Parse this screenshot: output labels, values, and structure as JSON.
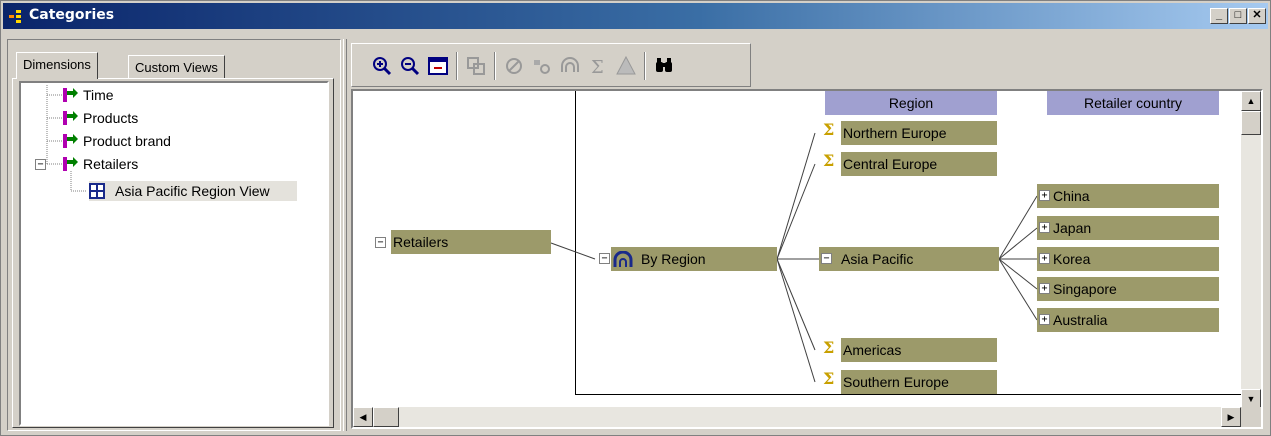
{
  "window": {
    "title": "Categories",
    "minimize": "_",
    "maximize": "□",
    "close": "✕"
  },
  "tabs": [
    {
      "label": "Dimensions"
    },
    {
      "label": "Custom Views"
    }
  ],
  "tree": {
    "items": [
      {
        "label": "Time"
      },
      {
        "label": "Products"
      },
      {
        "label": "Product brand"
      },
      {
        "label": "Retailers",
        "expander": "−"
      },
      {
        "label": "Asia Pacific Region View"
      }
    ]
  },
  "toolbar": {
    "icons": [
      "zoom-in-icon",
      "zoom-out-icon",
      "fit-to-window-icon",
      "copy-icon",
      "exclude-icon",
      "suppress-icon",
      "hierarchy-icon",
      "summary-icon",
      "triangle-icon",
      "find-icon"
    ]
  },
  "diagram": {
    "headers": {
      "region": "Region",
      "retailer_country": "Retailer country"
    },
    "root": {
      "label": "Retailers",
      "expander": "−"
    },
    "level": {
      "label": "By Region",
      "expander": "−"
    },
    "regions": [
      {
        "label": "Northern Europe",
        "kind": "summary"
      },
      {
        "label": "Central Europe",
        "kind": "summary"
      },
      {
        "label": "Asia Pacific",
        "kind": "expanded",
        "expander": "−"
      },
      {
        "label": "Americas",
        "kind": "summary"
      },
      {
        "label": "Southern Europe",
        "kind": "summary"
      }
    ],
    "countries": [
      {
        "label": "China",
        "expander": "+"
      },
      {
        "label": "Japan",
        "expander": "+"
      },
      {
        "label": "Korea",
        "expander": "+"
      },
      {
        "label": "Singapore",
        "expander": "+"
      },
      {
        "label": "Australia",
        "expander": "+"
      }
    ],
    "sigma": "Σ"
  },
  "colors": {
    "node": "#9c9a6a",
    "header": "#a0a0d0",
    "title_start": "#0a246a"
  }
}
